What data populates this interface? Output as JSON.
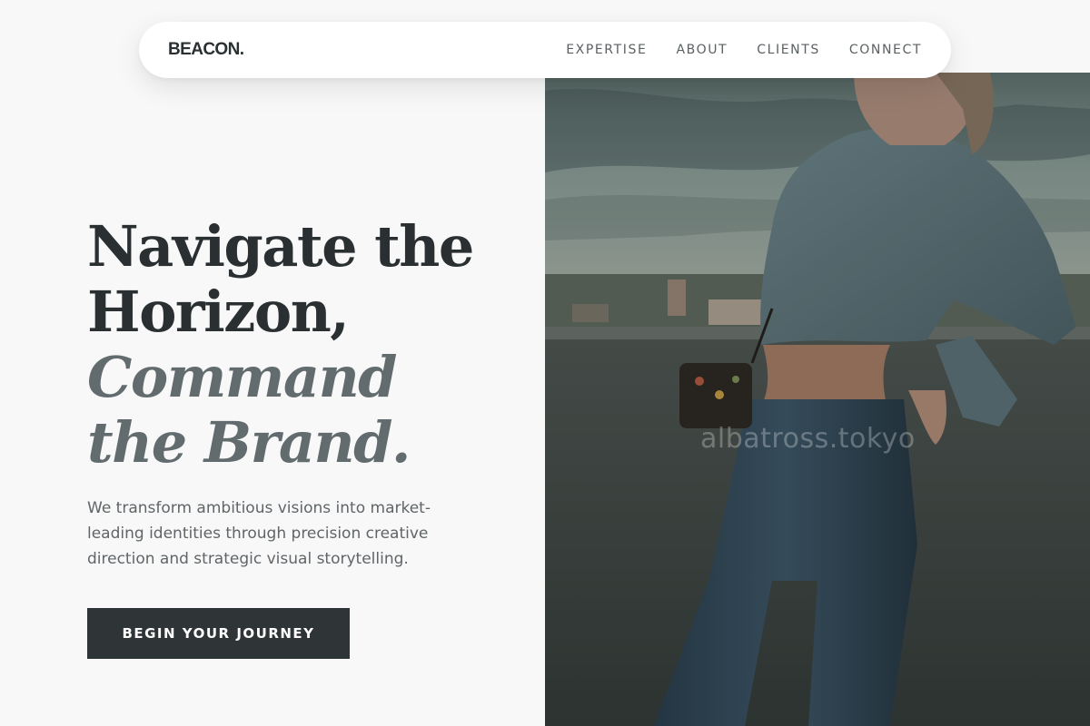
{
  "brand": {
    "logo": "BEACON."
  },
  "nav": {
    "items": [
      {
        "label": "EXPERTISE"
      },
      {
        "label": "ABOUT"
      },
      {
        "label": "CLIENTS"
      },
      {
        "label": "CONNECT"
      }
    ]
  },
  "hero": {
    "headline_line1": "Navigate the",
    "headline_line2": "Horizon,",
    "headline_accent_line1": "Command",
    "headline_accent_line2": "the Brand.",
    "subtext": "We transform ambitious visions into market-leading identities through precision creative direction and strategic visual storytelling.",
    "cta_label": "BEGIN YOUR JOURNEY"
  },
  "image": {
    "watermark": "albatross.tokyo"
  },
  "colors": {
    "background": "#f8f8f8",
    "text_dark": "#2a2f31",
    "text_accent": "#626b6e",
    "button_bg": "#2f3436"
  }
}
